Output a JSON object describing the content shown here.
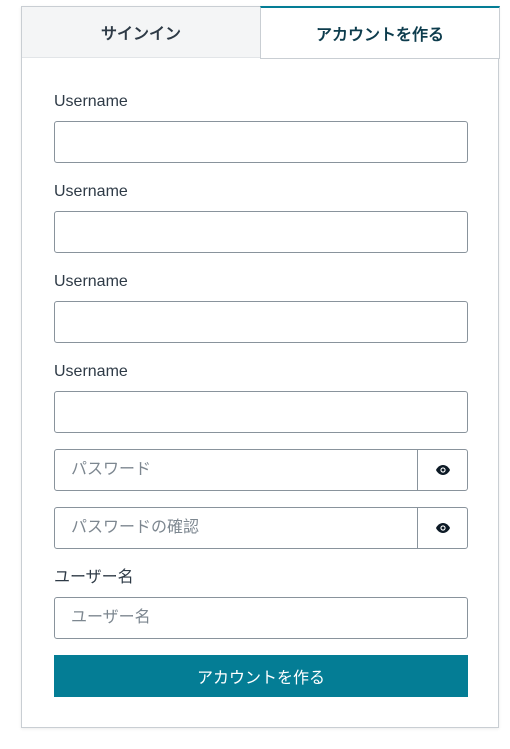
{
  "tabs": {
    "signin": "サインイン",
    "create_account": "アカウントを作る"
  },
  "form": {
    "fields": [
      {
        "label": "Username"
      },
      {
        "label": "Username"
      },
      {
        "label": "Username"
      },
      {
        "label": "Username"
      }
    ],
    "password": {
      "placeholder": "パスワード",
      "toggle_icon": "eye-icon"
    },
    "password_confirm": {
      "placeholder": "パスワードの確認",
      "toggle_icon": "eye-icon"
    },
    "username": {
      "label": "ユーザー名",
      "placeholder": "ユーザー名"
    },
    "submit_label": "アカウントを作る"
  },
  "colors": {
    "accent": "#047d95",
    "tab_inactive_bg": "#f4f5f6",
    "border": "#89939c"
  }
}
